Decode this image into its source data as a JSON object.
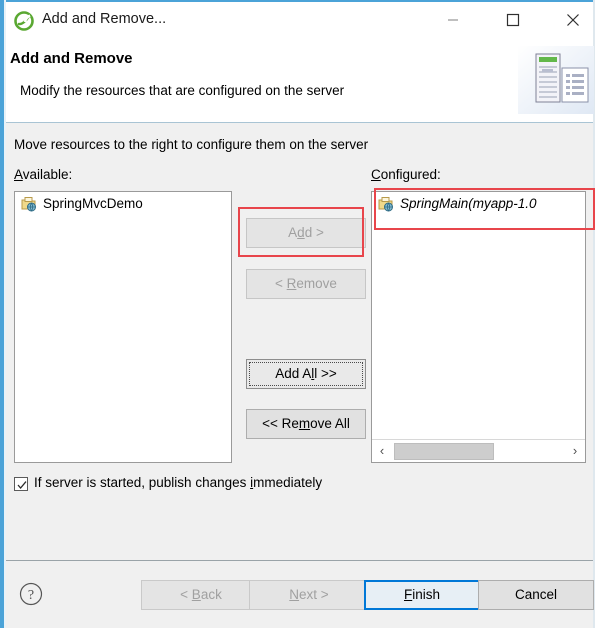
{
  "window": {
    "title": "Add and Remove...",
    "app_icon": "eclipse-logo-icon",
    "controls": {
      "minimize": "minimize-icon",
      "maximize": "maximize-icon",
      "close": "close-icon"
    }
  },
  "header": {
    "title": "Add and Remove",
    "subtitle": "Modify the resources that are configured on the server",
    "banner_icon": "server-and-document-icon"
  },
  "body": {
    "instruction": "Move resources to the right to configure them on the server",
    "available_label": "Available:",
    "available_mnemonic": "A",
    "configured_label": "Configured:",
    "configured_mnemonic": "C",
    "available_items": [
      {
        "label": "SpringMvcDemo",
        "icon": "module-globe-icon",
        "italic": false
      }
    ],
    "configured_items": [
      {
        "label": "SpringMain(myapp-1.0",
        "icon": "module-globe-icon",
        "italic": true
      }
    ],
    "scrollbar": {
      "left_arrow": "‹",
      "right_arrow": "›"
    },
    "transfer_buttons": [
      {
        "label": "Add >",
        "name": "add-button",
        "enabled": false,
        "focused": false
      },
      {
        "label": "< Remove",
        "name": "remove-button",
        "enabled": false,
        "focused": false
      },
      {
        "label": "Add All >>",
        "name": "add-all-button",
        "enabled": true,
        "focused": true
      },
      {
        "label": "<< Remove All",
        "name": "remove-all-button",
        "enabled": true,
        "focused": false
      }
    ],
    "checkbox": {
      "label": "If server is started, publish changes immediately",
      "checked": true
    }
  },
  "footer": {
    "help_icon": "help-question-icon",
    "buttons": [
      {
        "label": "< Back",
        "name": "back-button",
        "enabled": false,
        "default": false
      },
      {
        "label": "Next >",
        "name": "next-button",
        "enabled": false,
        "default": false
      },
      {
        "label": "Finish",
        "name": "finish-button",
        "enabled": true,
        "default": true
      },
      {
        "label": "Cancel",
        "name": "cancel-button",
        "enabled": true,
        "default": false
      }
    ]
  },
  "annotations": {
    "color": "#e8454b",
    "boxes": [
      "add-button-highlight",
      "configured-item-highlight"
    ]
  }
}
